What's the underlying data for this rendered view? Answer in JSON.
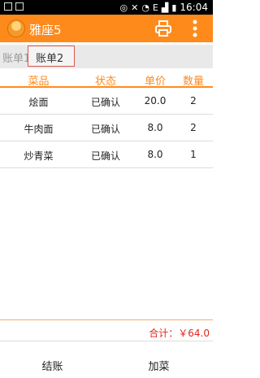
{
  "status_bar": {
    "time": "16:04",
    "network": "E"
  },
  "app": {
    "title": "雅座5"
  },
  "tabs": [
    {
      "label": "账单1"
    },
    {
      "label": "账单2"
    }
  ],
  "table": {
    "headers": [
      "菜品",
      "状态",
      "单价",
      "数量"
    ],
    "rows": [
      {
        "dish": "烩面",
        "status": "已确认",
        "price": "20.0",
        "qty": "2"
      },
      {
        "dish": "牛肉面",
        "status": "已确认",
        "price": "8.0",
        "qty": "2"
      },
      {
        "dish": "炒青菜",
        "status": "已确认",
        "price": "8.0",
        "qty": "1"
      }
    ]
  },
  "footer": {
    "total": "合计：￥64.0",
    "checkout_label": "结账",
    "add_label": "加菜"
  },
  "colors": {
    "accent": "#ff8a1c",
    "total": "#e3241b",
    "tab_highlight": "#d85a4e"
  },
  "icons": [
    "app-logo-icon",
    "print-icon",
    "more-vert-icon"
  ]
}
